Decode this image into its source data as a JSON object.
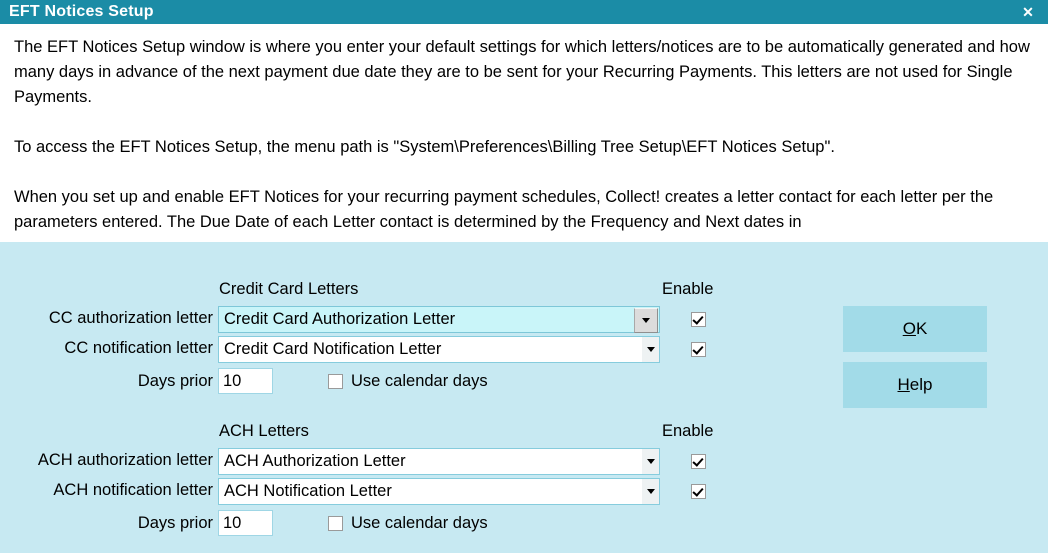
{
  "window": {
    "title": "EFT Notices Setup",
    "close_label": "✕"
  },
  "help": {
    "paragraph1": "The EFT Notices Setup window is where you enter your default settings for which letters/notices are to be automatically generated and how many days in advance of the next payment due date they are to be sent for your Recurring Payments. This letters are not used for Single Payments.",
    "paragraph2": "To access the EFT Notices Setup, the menu path is \"System\\Preferences\\Billing Tree Setup\\EFT Notices Setup\".",
    "paragraph3": "When you set up and enable EFT Notices for your recurring payment schedules, Collect! creates a letter contact for each letter per the parameters entered.  The Due Date of each Letter contact is determined by the Frequency and Next dates in"
  },
  "form": {
    "credit_card": {
      "header": "Credit Card Letters",
      "enable_header": "Enable",
      "authorization": {
        "label": "CC authorization letter",
        "value": "Credit Card Authorization Letter",
        "enabled": "checked"
      },
      "notification": {
        "label": "CC notification letter",
        "value": "Credit Card Notification Letter",
        "enabled": "checked"
      },
      "days_prior": {
        "label": "Days prior",
        "value": "10"
      },
      "use_calendar_days": {
        "label": "Use calendar days",
        "checked": "unchecked"
      }
    },
    "ach": {
      "header": "ACH Letters",
      "enable_header": "Enable",
      "authorization": {
        "label": "ACH authorization letter",
        "value": "ACH Authorization Letter",
        "enabled": "checked"
      },
      "notification": {
        "label": "ACH notification letter",
        "value": "ACH Notification Letter",
        "enabled": "checked"
      },
      "days_prior": {
        "label": "Days prior",
        "value": "10"
      },
      "use_calendar_days": {
        "label": "Use calendar days",
        "checked": "unchecked"
      }
    }
  },
  "buttons": {
    "ok": {
      "accel": "O",
      "rest": "K"
    },
    "help": {
      "accel": "H",
      "rest": "elp"
    }
  },
  "colors": {
    "titlebar": "#1b8ca6",
    "panel": "#c7e9f2",
    "button": "#a2dbe8",
    "focused_field": "#c9f5f9"
  }
}
